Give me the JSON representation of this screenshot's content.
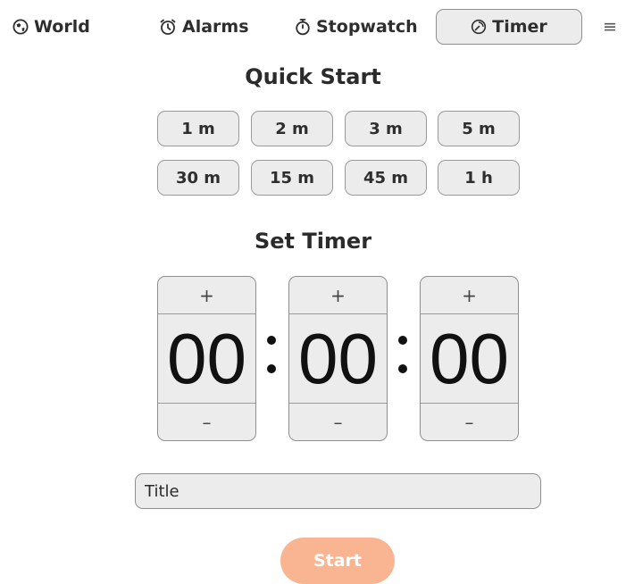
{
  "nav": {
    "world": {
      "label": "World",
      "icon": "globe-icon"
    },
    "alarms": {
      "label": "Alarms",
      "icon": "alarm-clock-icon"
    },
    "stopwatch": {
      "label": "Stopwatch",
      "icon": "stopwatch-icon"
    },
    "timer": {
      "label": "Timer",
      "icon": "timer-icon",
      "active": true
    },
    "menu_icon": "≡"
  },
  "quick_start": {
    "heading": "Quick Start",
    "presets": [
      "1 m",
      "2 m",
      "3 m",
      "5 m",
      "30 m",
      "15 m",
      "45 m",
      "1 h"
    ]
  },
  "set_timer": {
    "heading": "Set Timer",
    "plus_symbol": "+",
    "minus_symbol": "–",
    "hours": "00",
    "minutes": "00",
    "seconds": "00"
  },
  "title_field": {
    "placeholder": "Title",
    "value": ""
  },
  "start_button": {
    "label": "Start",
    "color": "#f9b592"
  }
}
